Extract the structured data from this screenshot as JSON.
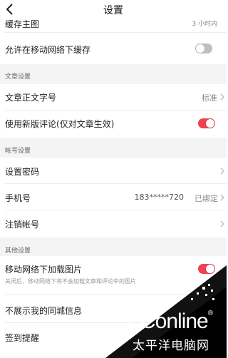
{
  "header": {
    "title": "设置"
  },
  "partial_row": {
    "label": "缓存主图",
    "value": "3 小时内"
  },
  "cellular_cache": {
    "label": "允许在移动网络下缓存",
    "enabled": false
  },
  "sections": {
    "article": "文章设置",
    "account": "帐号设置",
    "other": "其他设置"
  },
  "article_font_size": {
    "label": "文章正文字号",
    "value": "标准"
  },
  "new_comments": {
    "label": "使用新版评论(仅对文章生效)",
    "enabled": true
  },
  "set_password": {
    "label": "设置密码"
  },
  "phone": {
    "label": "手机号",
    "number": "183*****720",
    "status": "已绑定"
  },
  "cancel_account": {
    "label": "注销帐号"
  },
  "cellular_images": {
    "label": "移动网络下加载图片",
    "desc": "关闭后，移动网络下将不会加载文章和评论中的图片",
    "enabled": true
  },
  "hide_local": {
    "label": "不展示我的同城信息"
  },
  "checkin_reminder": {
    "label": "签到提醒"
  },
  "watermark": {
    "brand": "PConline",
    "brand_tm": "®",
    "cn": "太平洋电脑网"
  },
  "colors": {
    "toggle_on": "#ef4150",
    "toggle_off": "#bfbfbf",
    "section_bg": "#f4f4f4"
  }
}
